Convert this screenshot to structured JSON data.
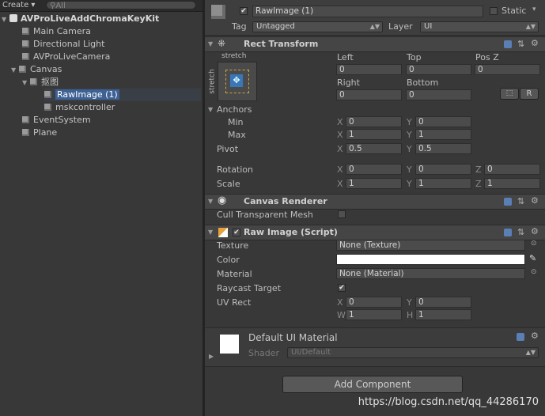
{
  "hierarchy": {
    "create_label": "Create",
    "search_placeholder": "All",
    "scene_name": "AVProLiveAddChromaKeyKit",
    "items": [
      {
        "label": "Main Camera"
      },
      {
        "label": "Directional Light"
      },
      {
        "label": "AVProLiveCamera"
      },
      {
        "label": "Canvas"
      },
      {
        "label": "抠图"
      },
      {
        "label": "RawImage (1)"
      },
      {
        "label": "mskcontroller"
      },
      {
        "label": "EventSystem"
      },
      {
        "label": "Plane"
      }
    ]
  },
  "inspector": {
    "object_name": "RawImage (1)",
    "static_label": "Static",
    "tag_label": "Tag",
    "tag_value": "Untagged",
    "layer_label": "Layer",
    "layer_value": "UI",
    "rect_transform": {
      "title": "Rect Transform",
      "stretch_top": "stretch",
      "stretch_side": "stretch",
      "left_label": "Left",
      "left_value": "0",
      "top_label": "Top",
      "top_value": "0",
      "posz_label": "Pos Z",
      "posz_value": "0",
      "right_label": "Right",
      "right_value": "0",
      "bottom_label": "Bottom",
      "bottom_value": "0",
      "r_label": "R",
      "anchors_label": "Anchors",
      "min_label": "Min",
      "min_x": "0",
      "min_y": "0",
      "max_label": "Max",
      "max_x": "1",
      "max_y": "1",
      "pivot_label": "Pivot",
      "pivot_x": "0.5",
      "pivot_y": "0.5",
      "rotation_label": "Rotation",
      "rot_x": "0",
      "rot_y": "0",
      "rot_z": "0",
      "scale_label": "Scale",
      "scale_x": "1",
      "scale_y": "1",
      "scale_z": "1",
      "x": "X",
      "y": "Y",
      "z": "Z"
    },
    "canvas_renderer": {
      "title": "Canvas Renderer",
      "cull_label": "Cull Transparent Mesh"
    },
    "raw_image": {
      "title": "Raw Image (Script)",
      "texture_label": "Texture",
      "texture_value": "None (Texture)",
      "color_label": "Color",
      "material_label": "Material",
      "material_value": "None (Material)",
      "raycast_label": "Raycast Target",
      "uvrect_label": "UV Rect",
      "uv_x": "0",
      "uv_y": "0",
      "uv_w": "1",
      "uv_h": "1",
      "w": "W",
      "h": "H"
    },
    "material": {
      "name": "Default UI Material",
      "shader_label": "Shader",
      "shader_value": "UI/Default"
    },
    "add_component_label": "Add Component"
  },
  "watermark": "https://blog.csdn.net/qq_44286170",
  "colors": {
    "selection": "#3d6194",
    "accent_icon": "#5a7fb5"
  }
}
